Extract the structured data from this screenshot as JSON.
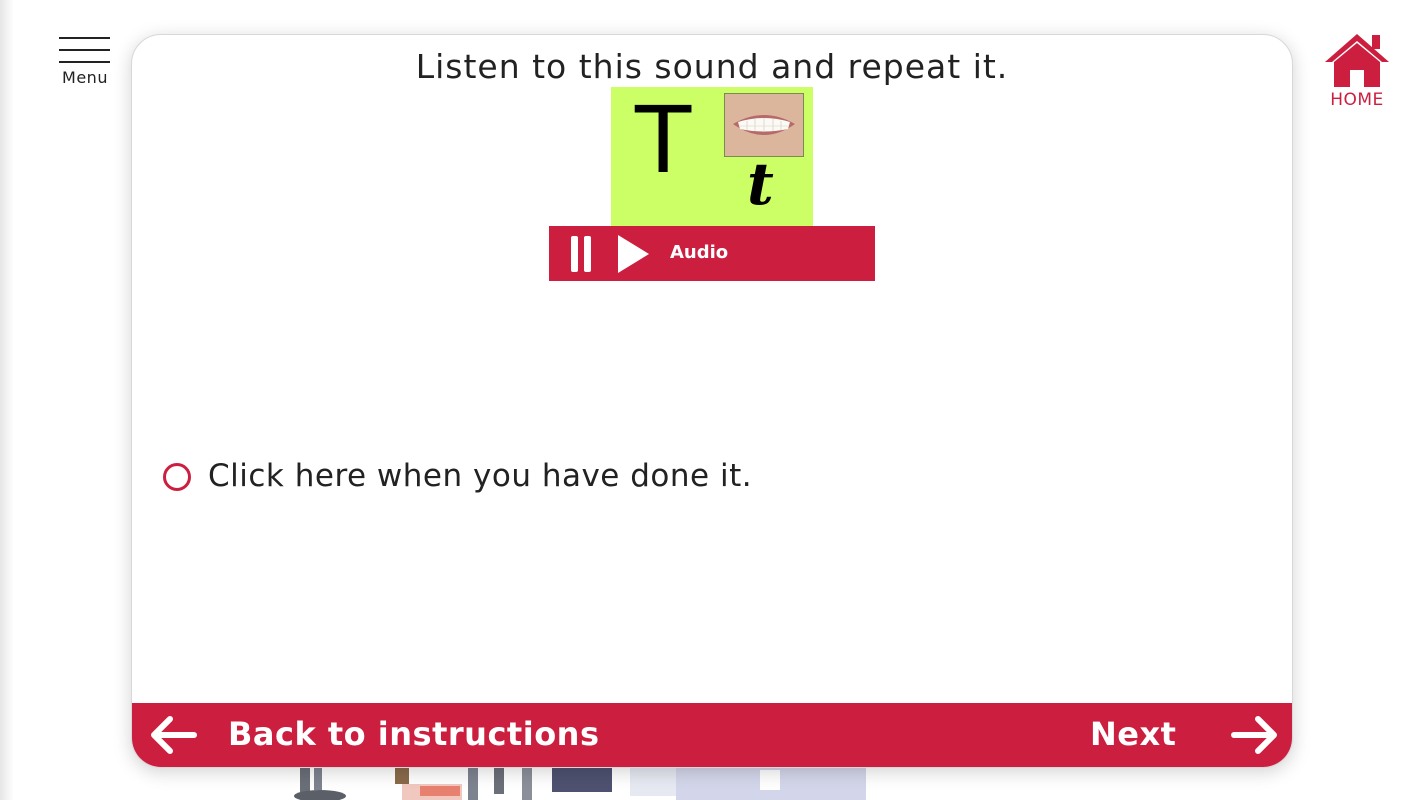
{
  "menu": {
    "label": "Menu"
  },
  "home": {
    "label": "HOME"
  },
  "question": {
    "title": "Listen to this sound and repeat it.",
    "letter_upper": "T",
    "letter_lower": "t"
  },
  "audio": {
    "label": "Audio"
  },
  "done_option": {
    "label": "Click here when you have done it."
  },
  "footer": {
    "back_label": "Back to instructions",
    "next_label": "Next"
  },
  "colors": {
    "accent": "#cc1f3f",
    "letter_card": "#ccff66"
  }
}
